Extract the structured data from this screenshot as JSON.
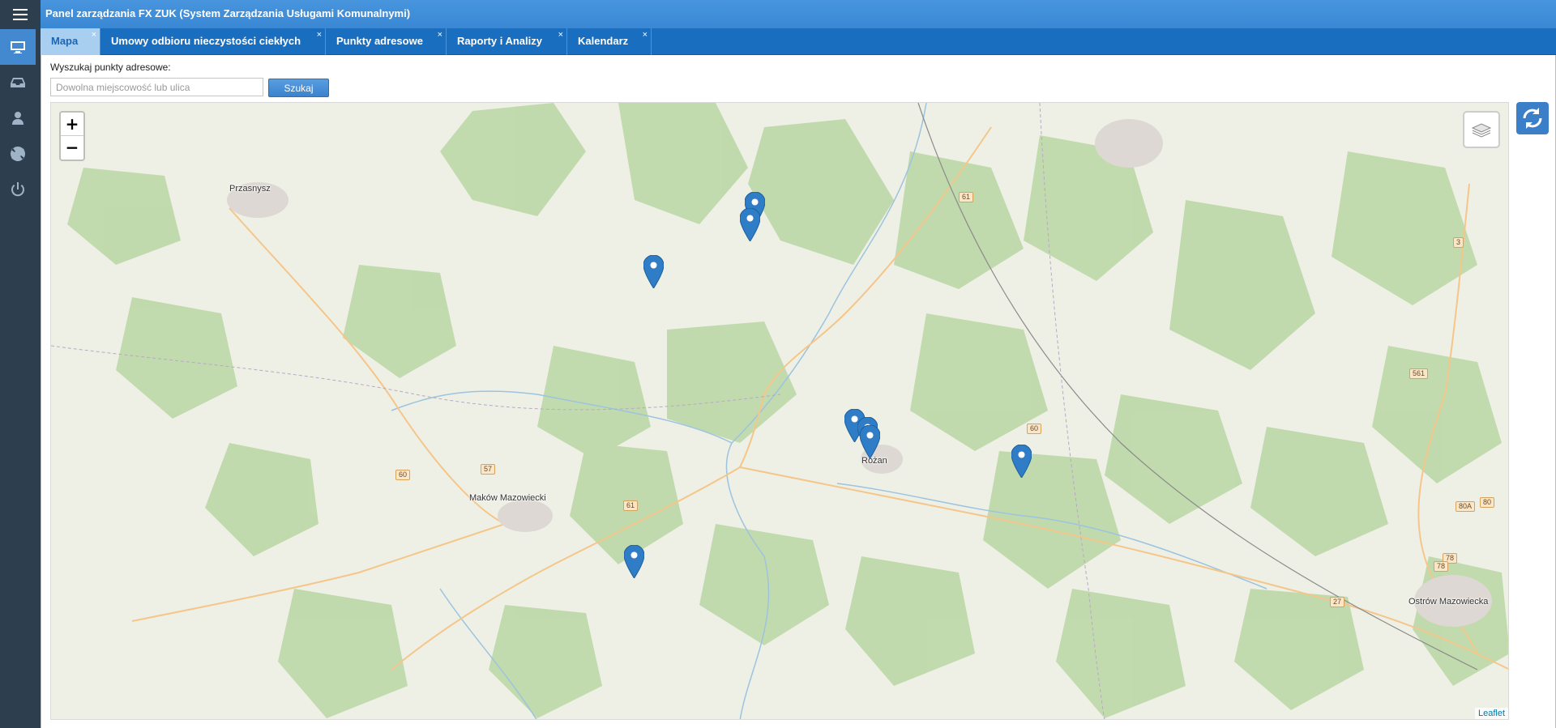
{
  "app": {
    "title": "Panel zarządzania FX ZUK (System Zarządzania Usługami Komunalnymi)"
  },
  "sidebar": {
    "items": [
      {
        "icon": "monitor-icon",
        "active": true
      },
      {
        "icon": "inbox-icon",
        "active": false
      },
      {
        "icon": "user-icon",
        "active": false
      },
      {
        "icon": "support-icon",
        "active": false
      },
      {
        "icon": "power-icon",
        "active": false
      }
    ]
  },
  "tabs": [
    {
      "label": "Mapa",
      "active": true
    },
    {
      "label": "Umowy odbioru nieczystości ciekłych",
      "active": false
    },
    {
      "label": "Punkty adresowe",
      "active": false
    },
    {
      "label": "Raporty i Analizy",
      "active": false
    },
    {
      "label": "Kalendarz",
      "active": false
    }
  ],
  "tab_close_symbol": "×",
  "search": {
    "label": "Wyszukaj punkty adresowe:",
    "placeholder": "Dowolna miejscowość lub ulica",
    "value": "",
    "button_label": "Szukaj"
  },
  "map": {
    "zoom_in": "+",
    "zoom_out": "−",
    "attribution": "Leaflet",
    "places": [
      "Przasnysz",
      "Różan",
      "Maków Mazowiecki",
      "Ostrów Mazowiecka"
    ],
    "roads": [
      "61",
      "60",
      "57",
      "60",
      "61",
      "561",
      "80",
      "80A",
      "78",
      "78",
      "3",
      "27"
    ],
    "marker_color": "#2f7dc6"
  },
  "colors": {
    "header": "#3a8ad8",
    "tabbar": "#1a6ec0",
    "sidebar": "#2d3e4f",
    "active_tab": "#a9cff0"
  }
}
